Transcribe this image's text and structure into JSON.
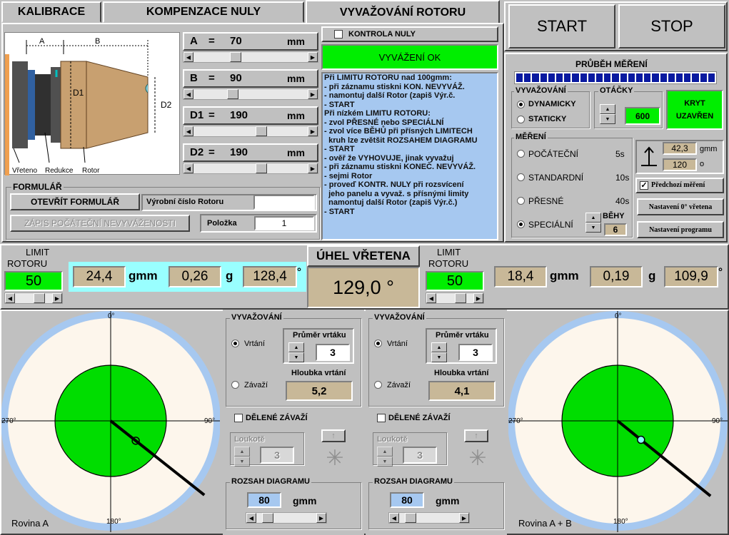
{
  "tabs": [
    "KALIBRACE",
    "KOMPENZACE NULY",
    "VYVAŽOVÁNÍ ROTORU"
  ],
  "diagram": {
    "a": "A",
    "b": "B",
    "d1": "D1",
    "d2": "D2",
    "vreteno": "Vřeteno",
    "redukce": "Redukce",
    "rotor": "Rotor"
  },
  "params": [
    {
      "name": "A",
      "eq": "=",
      "value": "70",
      "unit": "mm",
      "pos": 0.32
    },
    {
      "name": "B",
      "eq": "=",
      "value": "90",
      "unit": "mm",
      "pos": 0.3
    },
    {
      "name": "D1",
      "eq": "=",
      "value": "190",
      "unit": "mm",
      "pos": 0.55
    },
    {
      "name": "D2",
      "eq": "=",
      "value": "190",
      "unit": "mm",
      "pos": 0.55
    }
  ],
  "formular": {
    "title": "FORMULÁŘ",
    "open": "OTEVŘÍT FORMULÁŘ",
    "serial_label": "Výrobní číslo Rotoru",
    "serial_value": "",
    "zapis": "ZÁPIS POČÁTEČNÍ NEVYVÁŽENOSTI",
    "polozka_label": "Položka",
    "polozka_value": "1"
  },
  "kontrola": "KONTROLA NULY",
  "status": "VYVÁŽENÍ OK",
  "instructions": [
    "Při LIMITU ROTORU nad 100gmm:",
    "- při záznamu stiskni KON. NEVYVÁŽ.",
    "- namontuj další Rotor (zapiš Výr.č.",
    "- START",
    "Při nízkém LIMITU ROTORU:",
    "- zvol PŘESNÉ nebo SPECIÁLNÍ",
    "- zvol více BĚHŮ při přísných LIMITECH",
    "  kruh lze zvětšit ROZSAHEM DIAGRAMU",
    "- START",
    "- ověř že VYHOVUJE, jinak vyvažuj",
    "- při záznamu stiskni KONEČ. NEVYVÁŽ.",
    "- sejmi Rotor",
    "- proveď KONTR. NULY při rozsvícení",
    "  jeho panelu a vyvaž. s přísnými limity",
    "  namontuj další Rotor (zapiš Výr.č.)",
    "- START"
  ],
  "start": "START",
  "stop": "STOP",
  "prubeh": {
    "title": "PRŮBĚH MĚŘENÍ",
    "progress": 1.0,
    "segments": 25
  },
  "vyvazovani": {
    "title": "VYVAŽOVÁNÍ",
    "dynamic": "DYNAMICKY",
    "static": "STATICKY"
  },
  "otacky": {
    "title": "OTÁČKY",
    "value": "600"
  },
  "kryt": {
    "line1": "KRYT",
    "line2": "UZAVŘEN"
  },
  "mereni": {
    "title": "MĚŘENÍ",
    "items": [
      {
        "label": "POČÁTEČNÍ",
        "time": "5s"
      },
      {
        "label": "STANDARDNÍ",
        "time": "10s"
      },
      {
        "label": "PŘESNÉ",
        "time": "40s"
      },
      {
        "label": "SPECIÁLNÍ",
        "time": ""
      }
    ],
    "behy_label": "BĚHY",
    "behy_value": "6"
  },
  "tilt": {
    "gmm": "42,3",
    "gmm_unit": "gmm",
    "deg": "120",
    "deg_unit": "o"
  },
  "predchozi": "Předchozí měření",
  "nastaveni_vretena": "Nastavení 0° vřetena",
  "nastaveni_programu": "Nastavení programu",
  "limit_label1": "LIMIT",
  "limit_label2": "ROTORU",
  "left": {
    "limit": "50",
    "gmm": "24,4",
    "gmm_unit": "gmm",
    "g": "0,26",
    "g_unit": "g",
    "deg": "128,4",
    "deg_unit": "°"
  },
  "uhel": {
    "label": "ÚHEL VŘETENA",
    "value": "129,0 °"
  },
  "right": {
    "limit": "50",
    "gmm": "18,4",
    "gmm_unit": "gmm",
    "g": "0,19",
    "g_unit": "g",
    "deg": "109,9",
    "deg_unit": "°"
  },
  "panels": [
    {
      "vyv": "VYVAŽOVÁNÍ",
      "vrtani": "Vrtání",
      "zavazi": "Závaží",
      "prumer_label": "Průměr vrtáku",
      "prumer": "3",
      "hloubka_label": "Hloubka vrtání",
      "hloubka": "5,2",
      "delene": "DĚLENÉ ZÁVAŽÍ",
      "loukote": "Loukotě",
      "loukote_value": "3",
      "rozsah": "ROZSAH DIAGRAMU",
      "rozsah_value": "80",
      "rozsah_unit": "gmm"
    },
    {
      "vyv": "VYVAŽOVÁNÍ",
      "vrtani": "Vrtání",
      "zavazi": "Závaží",
      "prumer_label": "Průměr vrtáku",
      "prumer": "3",
      "hloubka_label": "Hloubka vrtání",
      "hloubka": "4,1",
      "delene": "DĚLENÉ ZÁVAŽÍ",
      "loukote": "Loukotě",
      "loukote_value": "3",
      "rozsah": "ROZSAH DIAGRAMU",
      "rozsah_value": "80",
      "rozsah_unit": "gmm"
    }
  ],
  "polar": [
    {
      "name": "Rovina A",
      "top": "0°",
      "right": "90°",
      "bottom": "180°",
      "left": "270°",
      "angle": 128.4,
      "magnitude": 0.34,
      "marker": "black"
    },
    {
      "name": "Rovina A + B",
      "top": "0°",
      "right": "90°",
      "bottom": "180°",
      "left": "270°",
      "angle": 129.0,
      "magnitude": 0.32,
      "marker": "cyan"
    }
  ],
  "colors": {
    "green": "#00ee00",
    "cyan": "#99ffff",
    "tan": "#c8b898",
    "blue": "#a6c8f0",
    "progress": "#0a1aa0",
    "lightblue": "#a6c8f0"
  }
}
